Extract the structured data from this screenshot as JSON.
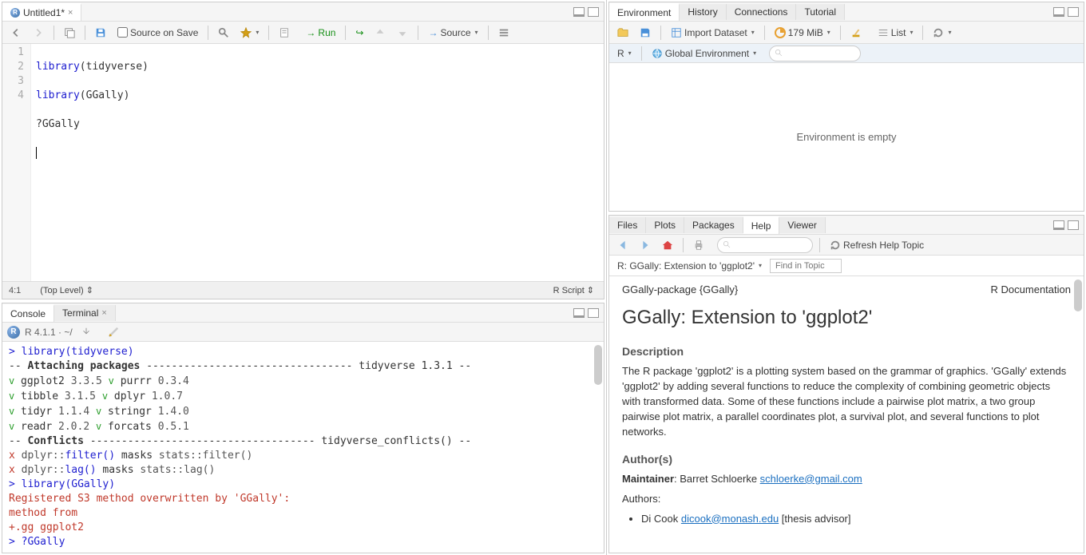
{
  "source": {
    "tab_title": "Untitled1*",
    "save_on_source": "Source on Save",
    "run_label": "Run",
    "source_btn": "Source",
    "lines": {
      "l1_kw": "library",
      "l1_arg": "(tidyverse)",
      "l2_kw": "library",
      "l2_arg": "(GGally)",
      "l3": "?GGally",
      "nums": {
        "n1": "1",
        "n2": "2",
        "n3": "3",
        "n4": "4"
      }
    },
    "status_pos": "4:1",
    "status_scope": "(Top Level) ",
    "status_lang": "R Script "
  },
  "console": {
    "tab_console": "Console",
    "tab_terminal": "Terminal",
    "r_version": "R 4.1.1 · ~/",
    "l1_p": ">",
    "l1_kw": "library",
    "l1_arg": "(tidyverse)",
    "l2a": "-- ",
    "l2b": "Attaching packages",
    "l2c": " --------------------------------- tidyverse 1.3.1 --",
    "l3_v": "v",
    "l3a": " ggplot2 ",
    "l3b": "3.3.5     ",
    "l3_v2": "v",
    "l3c": " purrr   ",
    "l3d": "0.3.4",
    "l4_v": "v",
    "l4a": " tibble  ",
    "l4b": "3.1.5     ",
    "l4_v2": "v",
    "l4c": " dplyr   ",
    "l4d": "1.0.7",
    "l5_v": "v",
    "l5a": " tidyr   ",
    "l5b": "1.1.4     ",
    "l5_v2": "v",
    "l5c": " stringr ",
    "l5d": "1.4.0",
    "l6_v": "v",
    "l6a": " readr   ",
    "l6b": "2.0.2     ",
    "l6_v2": "v",
    "l6c": " forcats ",
    "l6d": "0.5.1",
    "l7a": "-- ",
    "l7b": "Conflicts",
    "l7c": " ------------------------------------ tidyverse_conflicts() --",
    "l8_x": "x",
    "l8a": " dplyr::",
    "l8b": "filter()",
    "l8c": " masks ",
    "l8d": "stats::filter()",
    "l9_x": "x",
    "l9a": " dplyr::",
    "l9b": "lag()",
    "l9c": "    masks ",
    "l9d": "stats::lag()",
    "l10_p": ">",
    "l10_kw": " library",
    "l10_arg": "(GGally)",
    "l11": "Registered S3 method overwritten by 'GGally':",
    "l12": "  method from   ",
    "l13": "  +.gg   ggplot2",
    "l14_p": ">",
    "l14_rest": " ?GGally"
  },
  "env": {
    "tab_env": "Environment",
    "tab_hist": "History",
    "tab_conn": "Connections",
    "tab_tut": "Tutorial",
    "import": "Import Dataset",
    "mem": "179 MiB",
    "list": "List",
    "r_label": "R",
    "global_env": "Global Environment",
    "empty": "Environment is empty"
  },
  "help": {
    "tab_files": "Files",
    "tab_plots": "Plots",
    "tab_pkg": "Packages",
    "tab_help": "Help",
    "tab_viewer": "Viewer",
    "refresh": "Refresh Help Topic",
    "breadcrumb": "R: GGally: Extension to 'ggplot2'",
    "find_placeholder": "Find in Topic",
    "topline_left": "GGally-package {GGally}",
    "topline_right": "R Documentation",
    "h1": "GGally: Extension to 'ggplot2'",
    "h_desc": "Description",
    "desc": "The R package 'ggplot2' is a plotting system based on the grammar of graphics. 'GGally' extends 'ggplot2' by adding several functions to reduce the complexity of combining geometric objects with transformed data. Some of these functions include a pairwise plot matrix, a two group pairwise plot matrix, a parallel coordinates plot, a survival plot, and several functions to plot networks.",
    "h_auth": "Author(s)",
    "maint_label": "Maintainer",
    "maint_rest": ": Barret Schloerke ",
    "maint_email": "schloerke@gmail.com",
    "authors_label": "Authors:",
    "auth1_name": "Di Cook ",
    "auth1_email": "dicook@monash.edu",
    "auth1_rest": " [thesis advisor]"
  }
}
